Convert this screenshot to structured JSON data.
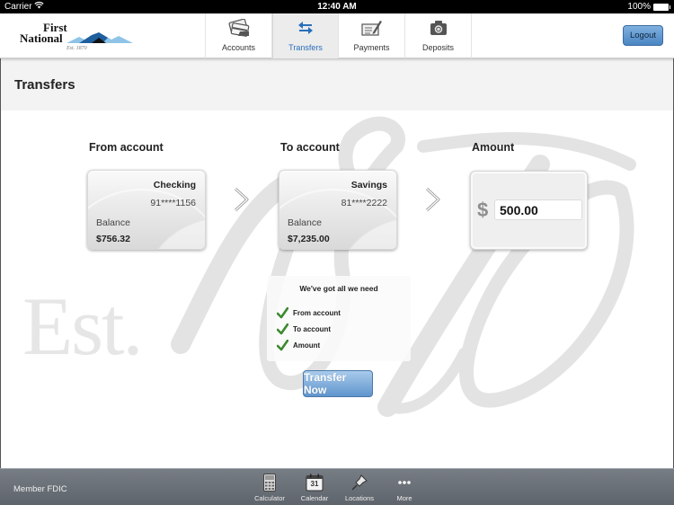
{
  "status_bar": {
    "carrier": "Carrier",
    "time": "12:40 AM",
    "battery": "100%"
  },
  "header": {
    "logo": {
      "line1": "First",
      "line2": "National",
      "tagline": "Est. 1870"
    },
    "tabs": [
      {
        "label": "Accounts",
        "icon": "credit-cards-icon",
        "active": false
      },
      {
        "label": "Transfers",
        "icon": "transfer-arrows-icon",
        "active": true
      },
      {
        "label": "Payments",
        "icon": "check-pen-icon",
        "active": false
      },
      {
        "label": "Deposits",
        "icon": "camera-icon",
        "active": false
      }
    ],
    "logout_label": "Logout"
  },
  "page": {
    "title": "Transfers",
    "watermark": {
      "est": "Est.",
      "year": "1870"
    }
  },
  "transfer": {
    "from_label": "From account",
    "to_label": "To account",
    "amount_label": "Amount",
    "from_account": {
      "name": "Checking",
      "number": "91****1156",
      "balance_label": "Balance",
      "balance": "$756.32"
    },
    "to_account": {
      "name": "Savings",
      "number": "81****2222",
      "balance_label": "Balance",
      "balance": "$7,235.00"
    },
    "amount": {
      "currency_symbol": "$",
      "value": "500.00"
    },
    "checklist": {
      "title": "We've got all we need",
      "items": [
        {
          "label": "From account",
          "checked": true
        },
        {
          "label": "To account",
          "checked": true
        },
        {
          "label": "Amount",
          "checked": true
        }
      ]
    },
    "submit_label": "Transfer Now"
  },
  "footer": {
    "member_text": "Member FDIC",
    "items": [
      {
        "label": "Calculator",
        "icon": "calculator-icon"
      },
      {
        "label": "Calendar",
        "icon": "calendar-icon",
        "day": "31"
      },
      {
        "label": "Locations",
        "icon": "pushpin-icon"
      },
      {
        "label": "More",
        "icon": "more-dots-icon"
      }
    ]
  },
  "colors": {
    "accent": "#2a6ebb",
    "button_blue": "#5f95cc",
    "check_green": "#3c8a2e",
    "footer_gray": "#6b7178"
  }
}
